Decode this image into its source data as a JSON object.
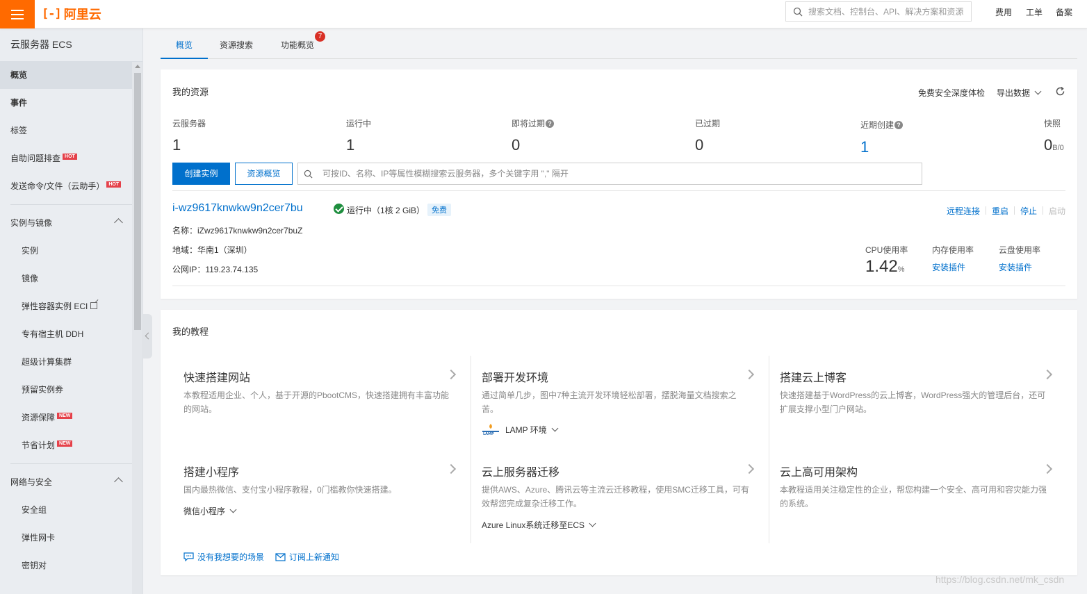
{
  "topbar": {
    "logo_mark": "[-]",
    "logo_text": "阿里云",
    "search_placeholder": "搜索文档、控制台、API、解决方案和资源",
    "links": [
      "费用",
      "工单",
      "备案"
    ]
  },
  "sidebar": {
    "title": "云服务器 ECS",
    "top_items": [
      {
        "label": "概览"
      },
      {
        "label": "事件"
      },
      {
        "label": "标签"
      },
      {
        "label": "自助问题排查",
        "badge": "HOT"
      },
      {
        "label": "发送命令/文件（云助手）",
        "badge": "HOT"
      }
    ],
    "group1": {
      "label": "实例与镜像",
      "items": [
        {
          "label": "实例"
        },
        {
          "label": "镜像"
        },
        {
          "label": "弹性容器实例 ECI"
        },
        {
          "label": "专有宿主机 DDH"
        },
        {
          "label": "超级计算集群"
        },
        {
          "label": "预留实例券"
        },
        {
          "label": "资源保障",
          "badge": "NEW"
        },
        {
          "label": "节省计划",
          "badge": "NEW"
        }
      ]
    },
    "group2": {
      "label": "网络与安全",
      "items": [
        {
          "label": "安全组"
        },
        {
          "label": "弹性网卡"
        },
        {
          "label": "密钥对"
        }
      ]
    }
  },
  "tabs": [
    {
      "label": "概览"
    },
    {
      "label": "资源搜索"
    },
    {
      "label": "功能概览",
      "badge": "7"
    }
  ],
  "resources": {
    "title": "我的资源",
    "free_check": "免费安全深度体检",
    "export": "导出数据",
    "stats": [
      {
        "label": "云服务器",
        "value": "1"
      },
      {
        "label": "运行中",
        "value": "1"
      },
      {
        "label": "即将过期",
        "value": "0"
      },
      {
        "label": "已过期",
        "value": "0"
      },
      {
        "label": "近期创建",
        "value": "1"
      },
      {
        "label": "快照",
        "value": "0",
        "unit": "B/0"
      }
    ],
    "create_button": "创建实例",
    "overview_button": "资源概览",
    "search_placeholder": "可按ID、名称、IP等属性模糊搜索云服务器，多个关键字用 \",\" 隔开",
    "instance": {
      "id": "i-wz9617knwkw9n2cer7bu",
      "status": "运行中（1核 2 GiB）",
      "free": "免费",
      "name_line": "名称：iZwz9617knwkw9n2cer7buZ",
      "region_line": "地域：华南1（深圳）",
      "ip_line": "公网IP：119.23.74.135",
      "actions": [
        "远程连接",
        "重启",
        "停止",
        "启动"
      ],
      "cpu_label": "CPU使用率",
      "cpu_value": "1.42",
      "cpu_unit": "%",
      "mem_label": "内存使用率",
      "mem_link": "安装插件",
      "disk_label": "云盘使用率",
      "disk_link": "安装插件"
    }
  },
  "tutorials": {
    "title": "我的教程",
    "items": [
      {
        "title": "快速搭建网站",
        "desc": "本教程适用企业、个人，基于开源的PbootCMS，快速搭建拥有丰富功能的网站。"
      },
      {
        "title": "部署开发环境",
        "desc": "通过简单几步，图中7种主流开发环境轻松部署，摆脱海量文档搜索之苦。",
        "dropdown": "LAMP 环境"
      },
      {
        "title": "搭建云上博客",
        "desc": "快速搭建基于WordPress的云上博客，WordPress强大的管理后台，还可扩展支撑小型门户网站。"
      },
      {
        "title": "搭建小程序",
        "desc": "国内最热微信、支付宝小程序教程，0门槛教你快速搭建。",
        "dropdown": "微信小程序"
      },
      {
        "title": "云上服务器迁移",
        "desc": "提供AWS、Azure、腾讯云等主流云迁移教程，使用SMC迁移工具，可有效帮您完成复杂迁移工作。",
        "dropdown": "Azure Linux系统迁移至ECS"
      },
      {
        "title": "云上高可用架构",
        "desc": "本教程适用关注稳定性的企业，帮您构建一个安全、高可用和容灾能力强的系统。"
      }
    ],
    "feedback": "没有我想要的场景",
    "subscribe": "订阅上新通知"
  },
  "watermark": "https://blog.csdn.net/mk_csdn",
  "colors": {
    "brand": "#ff6a00",
    "link": "#0070cc",
    "running": "#1e8e3e",
    "badge": "#d93026"
  }
}
